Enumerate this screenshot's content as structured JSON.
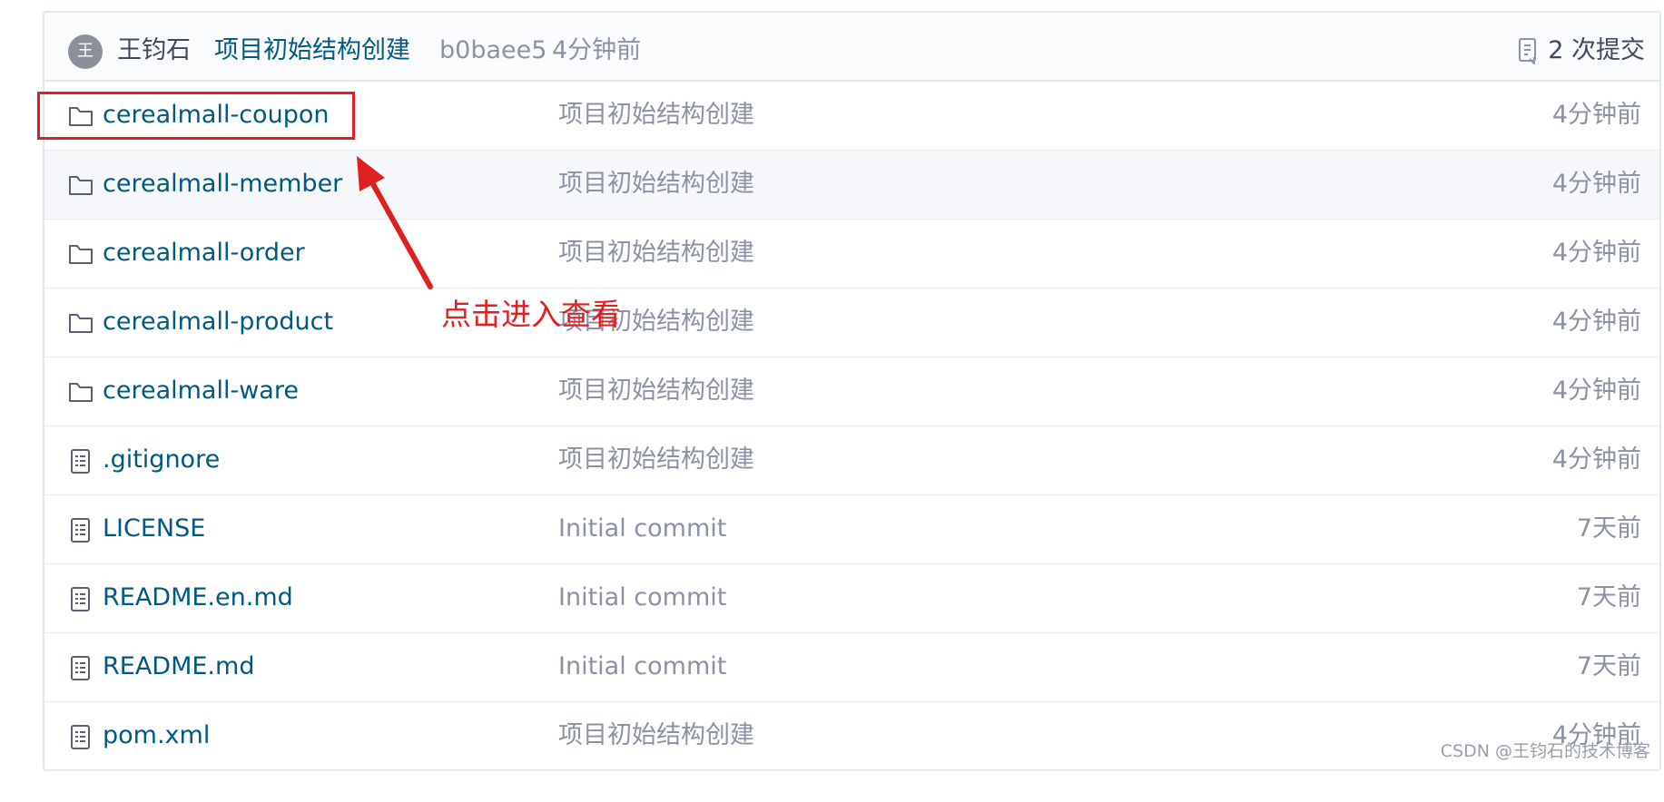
{
  "header": {
    "avatar_initial": "王",
    "author": "王钧石",
    "commit_message": "项目初始结构创建",
    "commit_hash": "b0baee5",
    "commit_time": "4分钟前",
    "commits_label": "2 次提交",
    "commits_icon": "commit-history-icon"
  },
  "files": [
    {
      "type": "folder",
      "name": "cerealmall-coupon",
      "message": "项目初始结构创建",
      "time": "4分钟前"
    },
    {
      "type": "folder",
      "name": "cerealmall-member",
      "message": "项目初始结构创建",
      "time": "4分钟前"
    },
    {
      "type": "folder",
      "name": "cerealmall-order",
      "message": "项目初始结构创建",
      "time": "4分钟前"
    },
    {
      "type": "folder",
      "name": "cerealmall-product",
      "message": "项目初始结构创建",
      "time": "4分钟前"
    },
    {
      "type": "folder",
      "name": "cerealmall-ware",
      "message": "项目初始结构创建",
      "time": "4分钟前"
    },
    {
      "type": "file",
      "name": ".gitignore",
      "message": "项目初始结构创建",
      "time": "4分钟前"
    },
    {
      "type": "file",
      "name": "LICENSE",
      "message": "Initial commit",
      "time": "7天前"
    },
    {
      "type": "file",
      "name": "README.en.md",
      "message": "Initial commit",
      "time": "7天前"
    },
    {
      "type": "file",
      "name": "README.md",
      "message": "Initial commit",
      "time": "7天前"
    },
    {
      "type": "file",
      "name": "pom.xml",
      "message": "项目初始结构创建",
      "time": "4分钟前"
    }
  ],
  "annotation": {
    "text": "点击进入查看",
    "color": "#e02020"
  },
  "watermark": "CSDN @王钧石的技术博客",
  "colors": {
    "link": "#005980",
    "muted": "#8c92a4",
    "text": "#40485b",
    "highlight": "#e02020"
  }
}
